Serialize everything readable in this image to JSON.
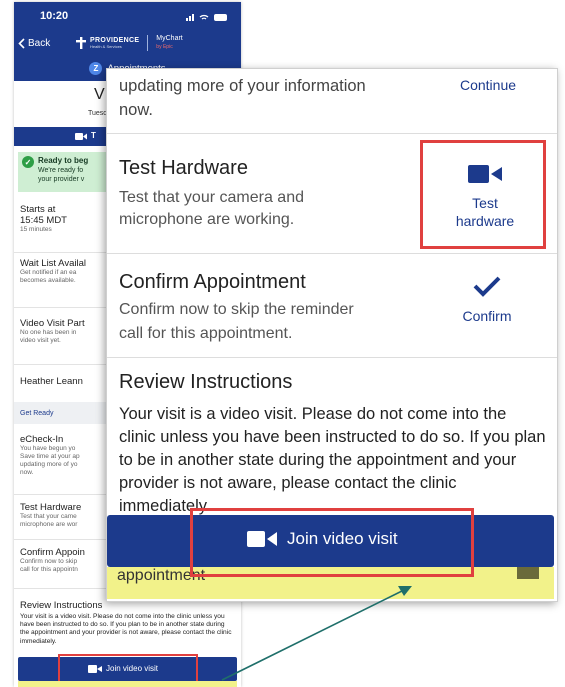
{
  "colors": {
    "brand": "#1c3a8c",
    "highlight": "#e0403f",
    "ready_bg": "#cfeed3",
    "ready_icon": "#2e9e46",
    "arrow": "#1f6f6a"
  },
  "phone": {
    "time": "10:20",
    "back": "Back",
    "brand": "PROVIDENCE",
    "brand_sub": "Health & Services",
    "mychart": "MyChart",
    "mychart_sub": "by Epic",
    "appointments": "Appointments",
    "avatar_letter": "Z",
    "visit_title": "V",
    "visit_date": "Tuesd",
    "video_bar": "T",
    "ready_title": "Ready to beg",
    "ready_text_1": "We're ready fo",
    "ready_text_2": "your provider v",
    "starts_label": "Starts at",
    "starts_time": "15:45 MDT",
    "starts_duration": "15 minutes",
    "waitlist_title": "Wait List Availal",
    "waitlist_text_1": "Get notified if an ea",
    "waitlist_text_2": "becomes available.",
    "participants_title": "Video Visit Part",
    "participants_text_1": "No one has been in",
    "participants_text_2": "video visit yet.",
    "provider": "Heather Leann",
    "get_ready": "Get Ready",
    "echeckin_title": "eCheck-In",
    "echeckin_text_1": "You have begun yo",
    "echeckin_text_2": "Save time at your ap",
    "echeckin_text_3": "updating more of yo",
    "echeckin_text_4": "now.",
    "test_title": "Test Hardware",
    "test_text_1": "Test that your came",
    "test_text_2": "microphone are wor",
    "confirm_title": "Confirm Appoin",
    "confirm_text_1": "Confirm now to skip",
    "confirm_text_2": "call for this appointn",
    "instructions_title": "Review Instructions",
    "instructions_text": "Your visit is a video visit. Please do not come into the clinic unless you have been instructed to do so. If you plan to be in another state during the appointment and your provider is not aware, please contact the clinic immediately.",
    "join": "Join video visit"
  },
  "zoom": {
    "top_text_1": "updating more of your information",
    "top_text_2": "now.",
    "continue": "Continue",
    "test_title": "Test Hardware",
    "test_desc_1": "Test that your camera and",
    "test_desc_2": "microphone are working.",
    "test_action_1": "Test",
    "test_action_2": "hardware",
    "confirm_title": "Confirm Appointment",
    "confirm_desc_1": "Confirm now to skip the reminder",
    "confirm_desc_2": "call for this appointment.",
    "confirm_action": "Confirm",
    "instructions_title": "Review Instructions",
    "instructions_text": "Your visit is a video visit. Please do not come into the clinic unless you have been instructed to do so. If you plan to be in another state during the appointment and your provider is not aware, please contact the clinic immediately.",
    "join": "Join video visit",
    "banner": "appointment"
  }
}
